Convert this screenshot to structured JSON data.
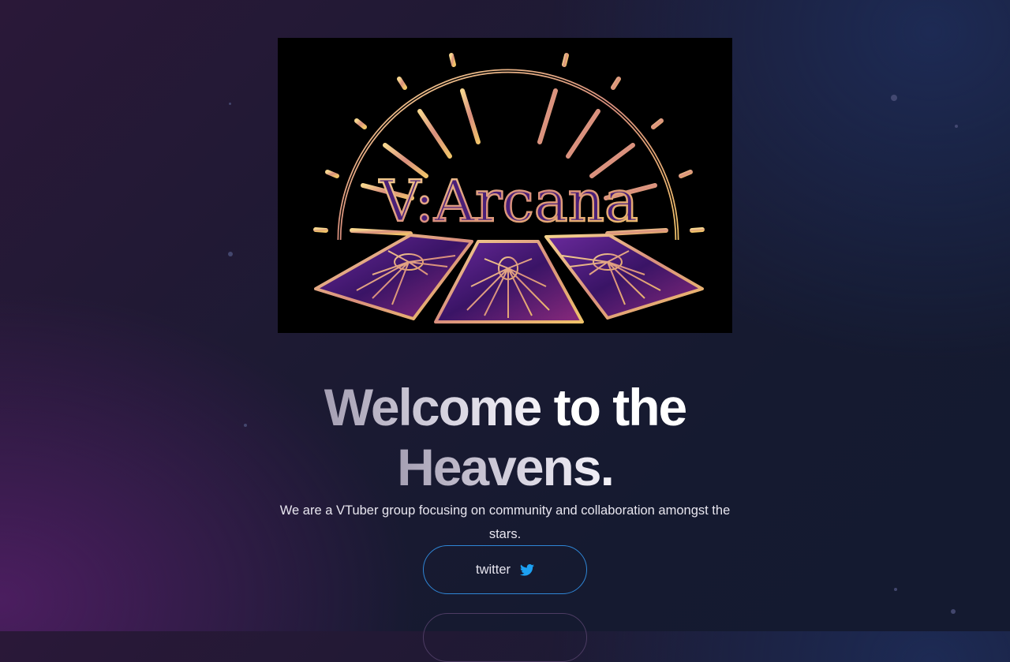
{
  "logo": {
    "wordmark": "V:Arcana",
    "alt": "V:Arcana logo"
  },
  "hero": {
    "headline_part1": "Welcome",
    "headline_part2": "to the",
    "headline_part3": "Heavens.",
    "subtitle": "We are a VTuber group focusing on community and collaboration amongst the stars."
  },
  "buttons": [
    {
      "label": "twitter",
      "icon": "twitter-bird-icon"
    },
    {
      "label": "",
      "icon": ""
    }
  ],
  "colors": {
    "accent_blue": "#1da1f2",
    "gold": "#f0c36a",
    "purple": "#5a2a8c",
    "background": "#1b1a32"
  }
}
